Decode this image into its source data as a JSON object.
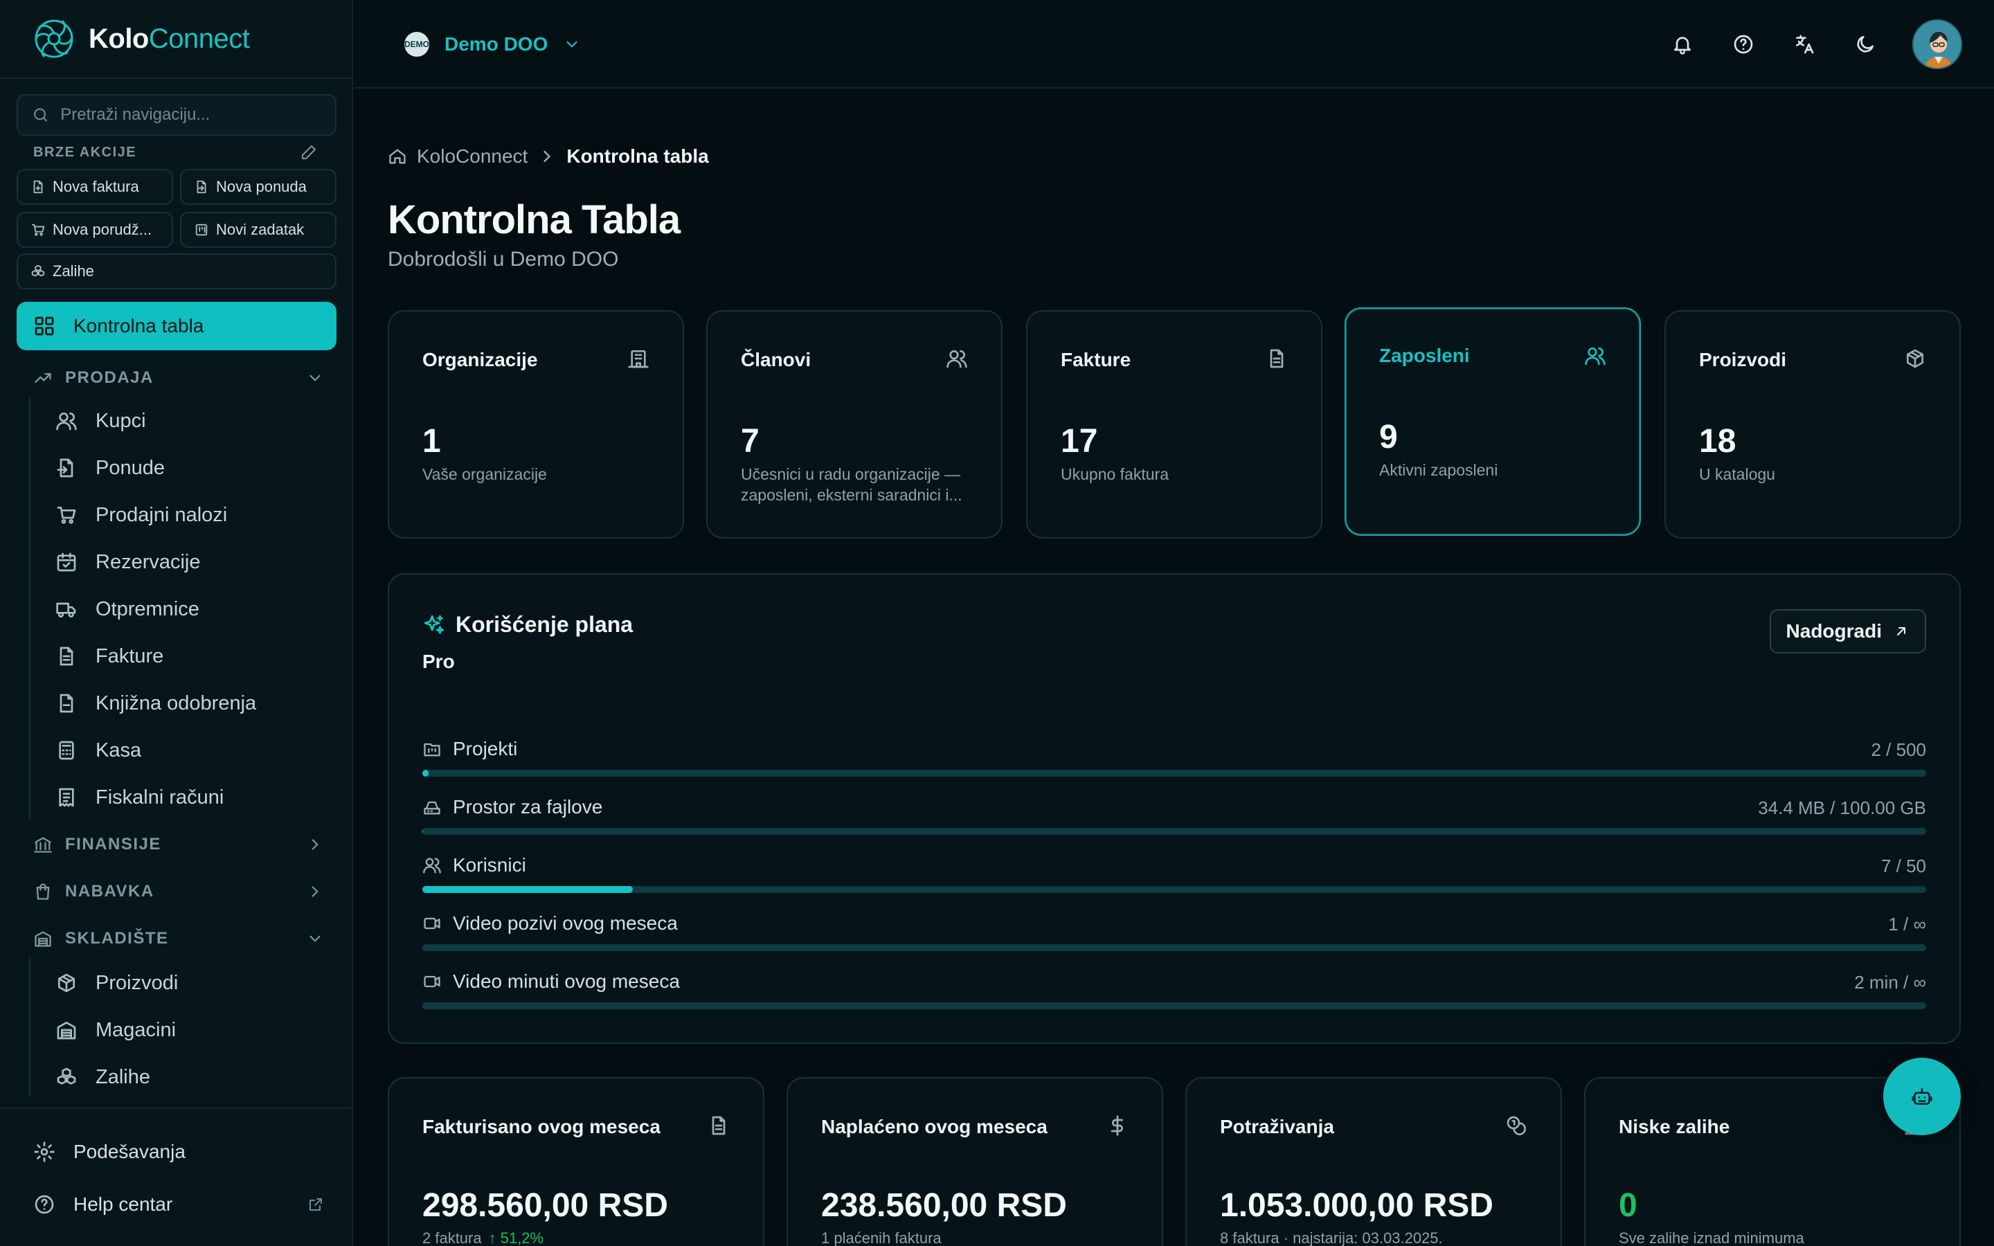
{
  "brand": {
    "part1": "Kolo",
    "part2": "Connect"
  },
  "sidebar": {
    "search_placeholder": "Pretraži navigaciju...",
    "quick_actions_title": "BRZE AKCIJE",
    "quick_actions": [
      {
        "label": "Nova faktura",
        "icon": "file-plus-icon"
      },
      {
        "label": "Nova ponuda",
        "icon": "file-import-icon"
      },
      {
        "label": "Nova porudž...",
        "icon": "cart-icon"
      },
      {
        "label": "Novi zadatak",
        "icon": "kanban-icon"
      },
      {
        "label": "Zalihe",
        "icon": "boxes-icon"
      }
    ],
    "active_item": "Kontrolna tabla",
    "sections": {
      "prodaja": "PRODAJA",
      "finansije": "FINANSIJE",
      "nabavka": "NABAVKA",
      "skladiste": "SKLADIŠTE"
    },
    "prodaja_items": [
      "Kupci",
      "Ponude",
      "Prodajni nalozi",
      "Rezervacije",
      "Otpremnice",
      "Fakture",
      "Knjižna odobrenja",
      "Kasa",
      "Fiskalni računi"
    ],
    "skladiste_items": [
      "Proizvodi",
      "Magacini",
      "Zalihe"
    ],
    "footer": {
      "settings": "Podešavanja",
      "help": "Help centar"
    }
  },
  "topbar": {
    "org_logo_text": "DEMO",
    "org_name": "Demo DOO"
  },
  "breadcrumb": {
    "home": "KoloConnect",
    "current": "Kontrolna tabla"
  },
  "page": {
    "title": "Kontrolna Tabla",
    "subtitle": "Dobrodošli u Demo DOO"
  },
  "stats": [
    {
      "title": "Organizacije",
      "value": "1",
      "desc": "Vaše organizacije",
      "icon": "building-icon"
    },
    {
      "title": "Članovi",
      "value": "7",
      "desc": "Učesnici u radu organizacije — zaposleni, eksterni saradnici i...",
      "icon": "users-icon"
    },
    {
      "title": "Fakture",
      "value": "17",
      "desc": "Ukupno faktura",
      "icon": "file-text-icon"
    },
    {
      "title": "Zaposleni",
      "value": "9",
      "desc": "Aktivni zaposleni",
      "icon": "users-icon"
    },
    {
      "title": "Proizvodi",
      "value": "18",
      "desc": "U katalogu",
      "icon": "package-icon"
    }
  ],
  "plan": {
    "title": "Korišćenje plana",
    "tier": "Pro",
    "upgrade_label": "Nadogradi",
    "usage": [
      {
        "label": "Projekti",
        "value": "2 / 500",
        "fraction": 0.004,
        "icon": "folder-kanban-icon"
      },
      {
        "label": "Prostor za fajlove",
        "value": "34.4 MB / 100.00 GB",
        "fraction": 0.0003,
        "icon": "hard-drive-icon"
      },
      {
        "label": "Korisnici",
        "value": "7 / 50",
        "fraction": 0.14,
        "icon": "users-icon"
      },
      {
        "label": "Video pozivi ovog meseca",
        "value": "1 / ∞",
        "fraction": 0,
        "icon": "video-icon"
      },
      {
        "label": "Video minuti ovog meseca",
        "value": "2 min / ∞",
        "fraction": 0,
        "icon": "video-icon"
      }
    ]
  },
  "finance": [
    {
      "title": "Fakturisano ovog meseca",
      "value": "298.560,00 RSD",
      "sub": "2 faktura",
      "trend": "↑ 51,2%",
      "icon": "file-text-icon"
    },
    {
      "title": "Naplaćeno ovog meseca",
      "value": "238.560,00 RSD",
      "sub": "1 plaćenih faktura",
      "trend": "",
      "icon": "dollar-icon"
    },
    {
      "title": "Potraživanja",
      "value": "1.053.000,00 RSD",
      "sub": "8 faktura · najstarija: 03.03.2025.",
      "trend": "",
      "icon": "coins-icon"
    },
    {
      "title": "Niske zalihe",
      "value": "0",
      "sub": "Sve zalihe iznad minimuma",
      "trend": "",
      "icon": "alert-icon"
    }
  ],
  "colors": {
    "accent": "#18c1c1",
    "background": "#040d12",
    "card": "#06141a",
    "positive": "#1fbf5f"
  }
}
